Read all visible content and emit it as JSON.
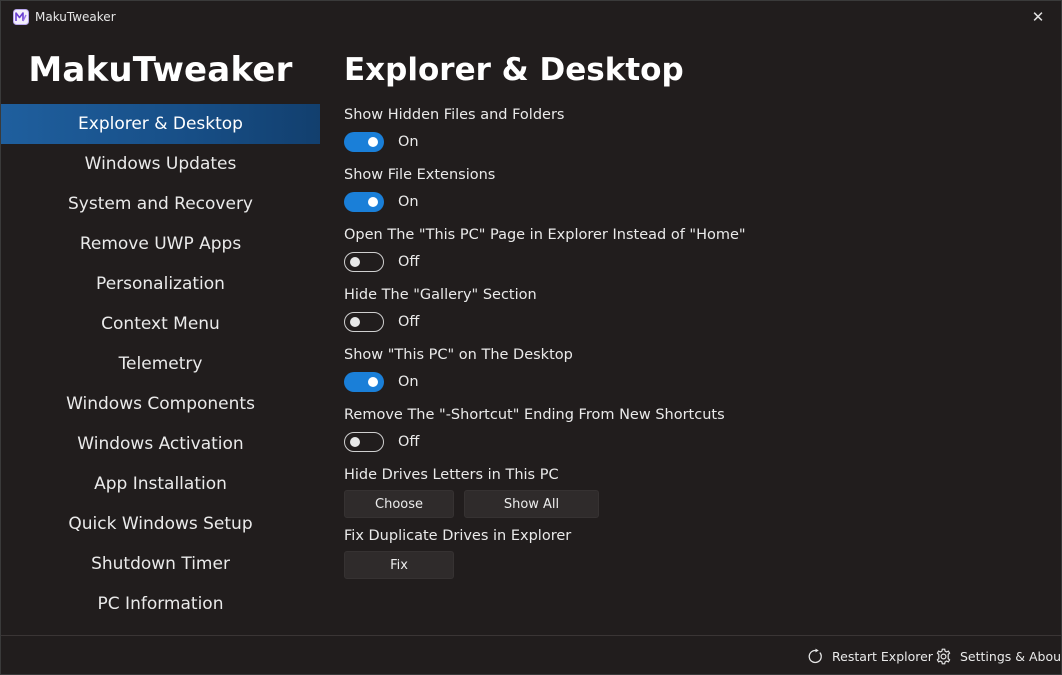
{
  "window": {
    "title": "MakuTweaker",
    "close_glyph": "✕"
  },
  "sidebar": {
    "brand": "MakuTweaker",
    "items": [
      {
        "label": "Explorer & Desktop",
        "active": true
      },
      {
        "label": "Windows Updates"
      },
      {
        "label": "System and Recovery"
      },
      {
        "label": "Remove UWP Apps"
      },
      {
        "label": "Personalization"
      },
      {
        "label": "Context Menu"
      },
      {
        "label": "Telemetry"
      },
      {
        "label": "Windows Components"
      },
      {
        "label": "Windows Activation"
      },
      {
        "label": "App Installation"
      },
      {
        "label": "Quick Windows Setup"
      },
      {
        "label": "Shutdown Timer"
      },
      {
        "label": "PC Information"
      }
    ]
  },
  "main": {
    "title": "Explorer & Desktop",
    "toggles": [
      {
        "label": "Show Hidden Files and Folders",
        "state": "On",
        "checked": true
      },
      {
        "label": "Show File Extensions",
        "state": "On",
        "checked": true
      },
      {
        "label": "Open The \"This PC\" Page in Explorer Instead of \"Home\"",
        "state": "Off",
        "checked": false
      },
      {
        "label": "Hide The \"Gallery\" Section",
        "state": "Off",
        "checked": false
      },
      {
        "label": "Show \"This PC\" on The Desktop",
        "state": "On",
        "checked": true
      },
      {
        "label": "Remove The \"-Shortcut\" Ending From New Shortcuts",
        "state": "Off",
        "checked": false
      }
    ],
    "drive_letters": {
      "label": "Hide Drives Letters in This PC",
      "choose_label": "Choose",
      "show_all_label": "Show All"
    },
    "duplicate_drives": {
      "label": "Fix Duplicate Drives in Explorer",
      "fix_label": "Fix"
    }
  },
  "footer": {
    "restart_label": "Restart Explorer",
    "restart_icon": "refresh-icon",
    "settings_label": "Settings & About",
    "settings_icon": "gear-icon"
  },
  "colors": {
    "accent": "#1a7fd8",
    "active_nav": "#1f5f9e",
    "background": "#211d1d"
  }
}
